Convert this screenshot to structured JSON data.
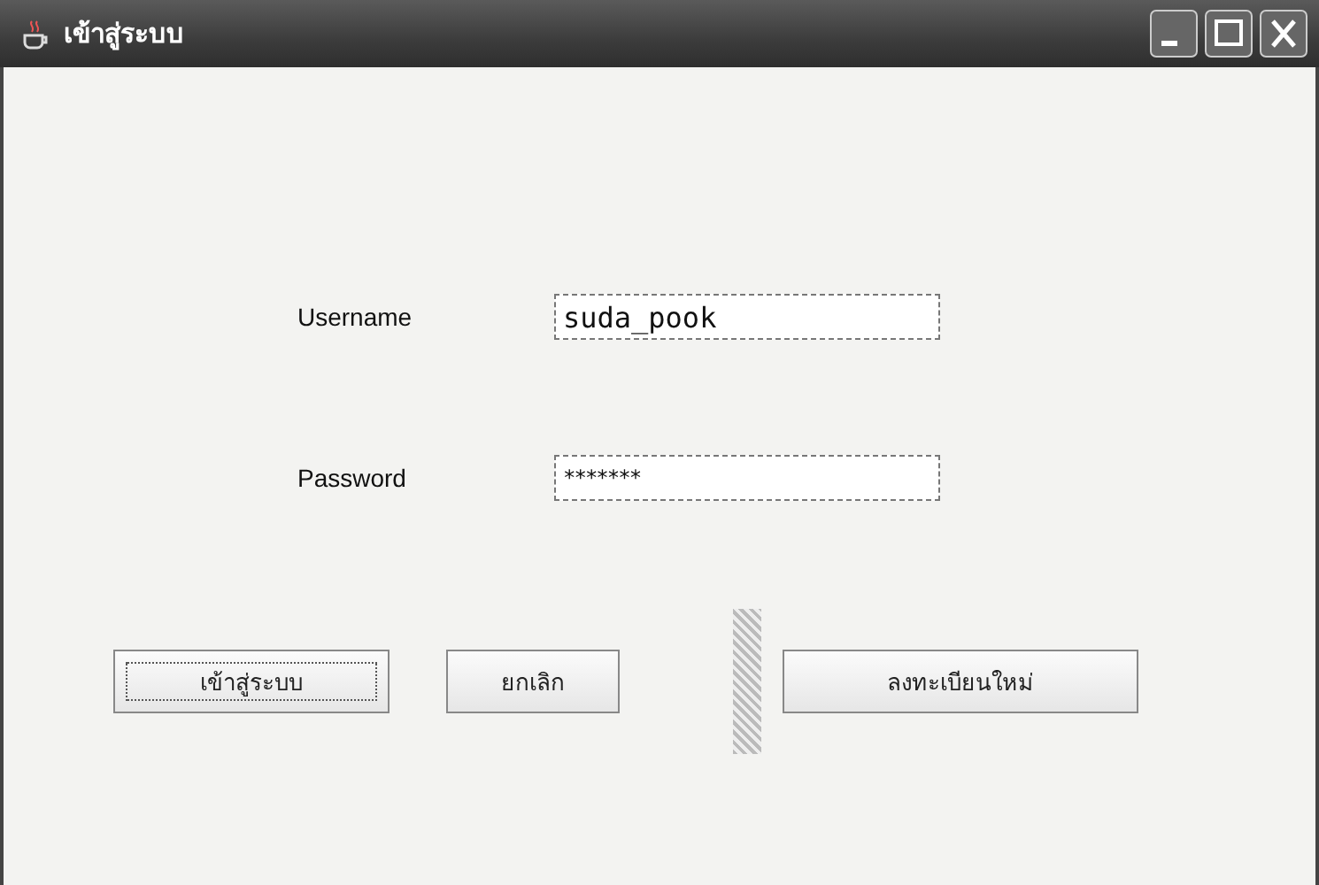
{
  "window": {
    "title": "เข้าสู่ระบบ"
  },
  "fields": [
    {
      "label": "Username",
      "value": "suda_pook",
      "kind": "text"
    },
    {
      "label": "Password",
      "value": "*******",
      "kind": "password"
    }
  ],
  "buttons": [
    {
      "label": "เข้าสู่ระบบ",
      "focused": true
    },
    {
      "label": "ยกเลิก",
      "focused": false
    },
    {
      "label": "ลงทะเบียนใหม่",
      "focused": false
    }
  ]
}
